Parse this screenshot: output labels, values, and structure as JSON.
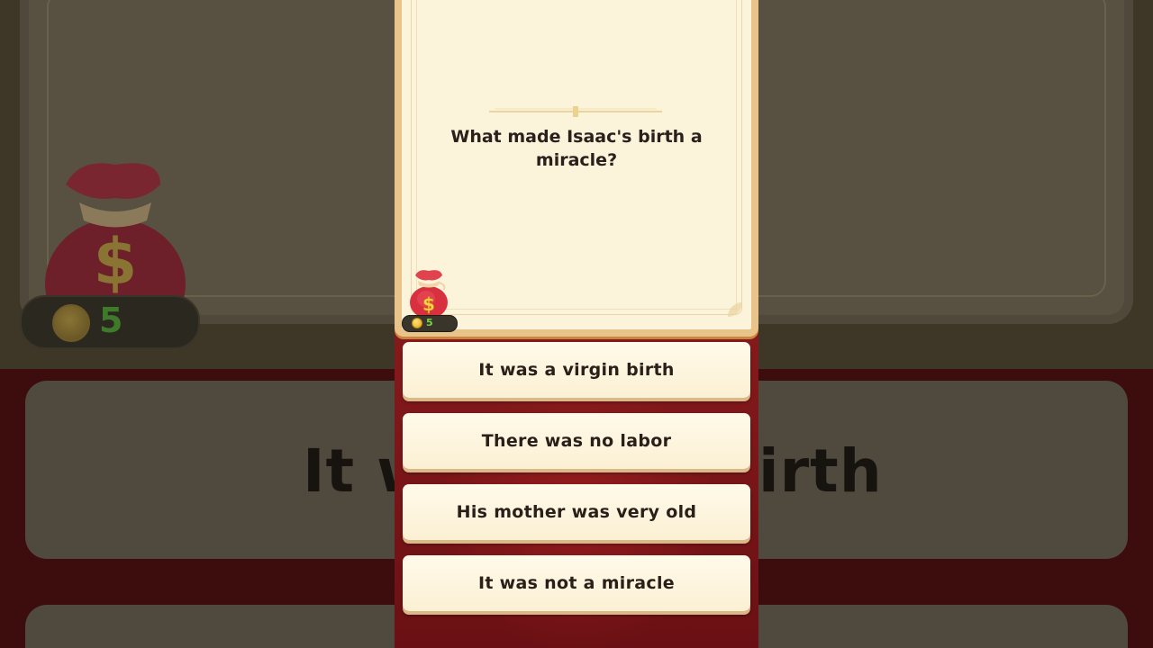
{
  "quiz": {
    "question": "What made Isaac's birth a miracle?",
    "answers": [
      {
        "label": "It was a virgin birth"
      },
      {
        "label": "There was no labor"
      },
      {
        "label": "His mother was very old"
      },
      {
        "label": "It was not a miracle"
      }
    ]
  },
  "wallet": {
    "coin_count": "5",
    "icon": "money-bag-icon"
  },
  "background_zoom": {
    "coin_count": "5",
    "answer_fragment_left": "It w",
    "answer_fragment_right": "irth"
  },
  "colors": {
    "card_bg": "#fbf3da",
    "card_border": "#e9c48a",
    "answer_bg": "#fbf0d3",
    "panel_red": "#861a1c",
    "coin_count_green": "#7cd24a"
  }
}
